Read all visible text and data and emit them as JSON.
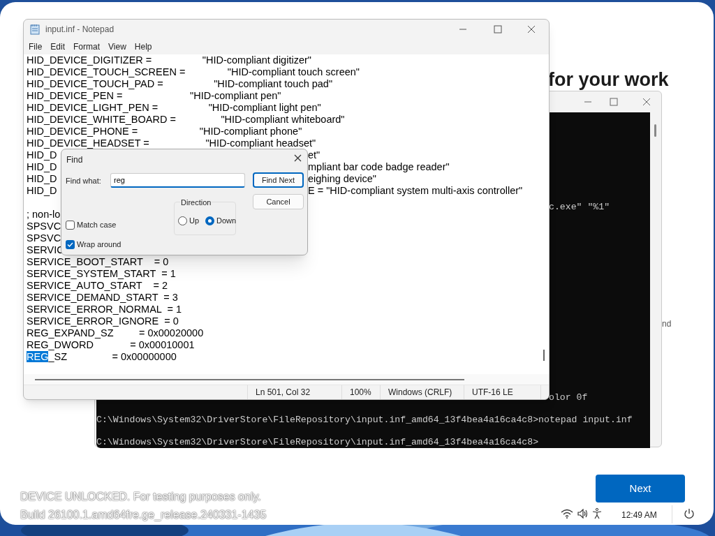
{
  "setup_page": {
    "heading": "for your work",
    "side_text": "nd",
    "next_button": "Next",
    "notice_lines": [
      "DEVICE UNLOCKED. For testing purposes only.",
      "Build 26100.1.amd64fre.ge_release.240331-1435"
    ],
    "clock": "12:49 AM"
  },
  "terminal": {
    "lines": [
      "c.exe\" \"%1\"",
      "olor 0f",
      "C:\\Windows\\System32\\DriverStore\\FileRepository\\input.inf_amd64_13f4bea4a16ca4c8>notepad input.inf",
      "C:\\Windows\\System32\\DriverStore\\FileRepository\\input.inf_amd64_13f4bea4a16ca4c8>"
    ]
  },
  "notepad": {
    "title": "input.inf - Notepad",
    "menu": [
      "File",
      "Edit",
      "Format",
      "View",
      "Help"
    ],
    "lines": [
      {
        "kind": "line",
        "text": "HID_DEVICE_DIGITIZER =                  \"HID-compliant digitizer\""
      },
      {
        "kind": "line",
        "text": "HID_DEVICE_TOUCH_SCREEN =               \"HID-compliant touch screen\""
      },
      {
        "kind": "line",
        "text": "HID_DEVICE_TOUCH_PAD =                  \"HID-compliant touch pad\""
      },
      {
        "kind": "line",
        "text": "HID_DEVICE_PEN =                        \"HID-compliant pen\""
      },
      {
        "kind": "line",
        "text": "HID_DEVICE_LIGHT_PEN =                  \"HID-compliant light pen\""
      },
      {
        "kind": "line",
        "text": "HID_DEVICE_WHITE_BOARD =                \"HID-compliant whiteboard\""
      },
      {
        "kind": "line",
        "text": "HID_DEVICE_PHONE =                      \"HID-compliant phone\""
      },
      {
        "kind": "line",
        "text": "HID_DEVICE_HEADSET =                    \"HID-compliant headset\""
      },
      {
        "kind": "split",
        "left": "HID_D",
        "right": "et\""
      },
      {
        "kind": "split",
        "left": "HID_D",
        "right": "mpliant bar code badge reader\""
      },
      {
        "kind": "split",
        "left": "HID_D",
        "right": "eighing device\""
      },
      {
        "kind": "split",
        "left": "HID_D",
        "right": "E = \"HID-compliant system multi-axis controller\""
      },
      {
        "kind": "blank"
      },
      {
        "kind": "line",
        "text": "; non-lo"
      },
      {
        "kind": "line",
        "text": "SPSVC"
      },
      {
        "kind": "line",
        "text": "SPSVC"
      },
      {
        "kind": "line",
        "text": "SERVIC"
      },
      {
        "kind": "line",
        "text": "SERVICE_BOOT_START    = 0"
      },
      {
        "kind": "line",
        "text": "SERVICE_SYSTEM_START  = 1"
      },
      {
        "kind": "line",
        "text": "SERVICE_AUTO_START    = 2"
      },
      {
        "kind": "line",
        "text": "SERVICE_DEMAND_START  = 3"
      },
      {
        "kind": "line",
        "text": "SERVICE_ERROR_NORMAL  = 1"
      },
      {
        "kind": "line",
        "text": "SERVICE_ERROR_IGNORE  = 0"
      },
      {
        "kind": "line",
        "text": "REG_EXPAND_SZ         = 0x00020000"
      },
      {
        "kind": "line",
        "text": "REG_DWORD             = 0x00010001"
      },
      {
        "kind": "match",
        "match": "REG",
        "text": "_SZ                = 0x00000000"
      }
    ],
    "status": [
      "Ln 501, Col 32",
      "100%",
      "Windows (CRLF)",
      "UTF-16 LE"
    ]
  },
  "find_dialog": {
    "title": "Find",
    "find_what_label": "Find what:",
    "find_what_value": "reg",
    "buttons": [
      "Find Next",
      "Cancel"
    ],
    "direction": {
      "label": "Direction",
      "options": [
        {
          "label": "Up",
          "selected": false
        },
        {
          "label": "Down",
          "selected": true
        }
      ]
    },
    "options": [
      {
        "label": "Match case",
        "checked": false
      },
      {
        "label": "Wrap around",
        "checked": true
      }
    ]
  }
}
